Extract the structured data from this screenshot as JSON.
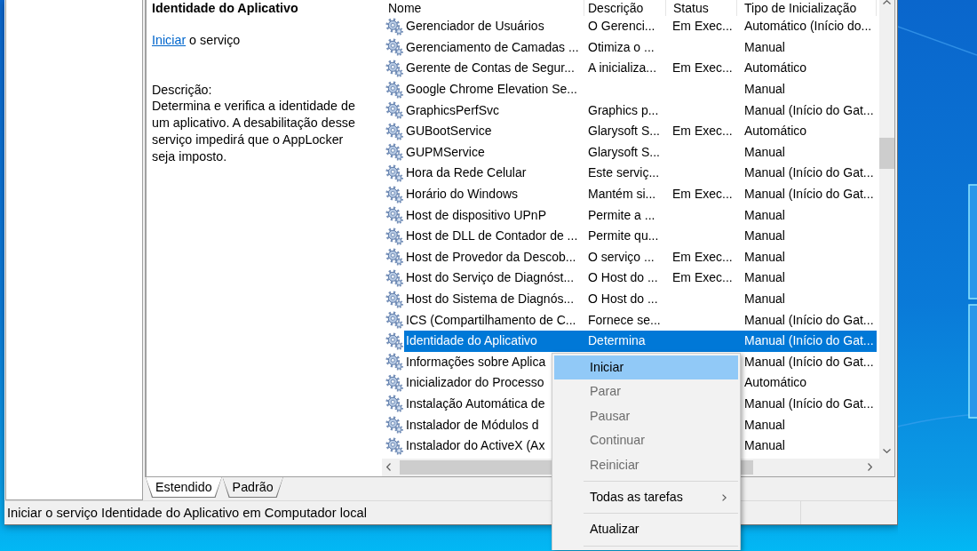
{
  "description_panel": {
    "title": "Identidade do Aplicativo",
    "action_link": "Iniciar",
    "action_text": "o serviço",
    "description_label": "Descrição:",
    "description": "Determina e verifica a identidade de um aplicativo. A desabilitação desse serviço impedirá que o AppLocker seja imposto."
  },
  "services_list": {
    "columns": [
      "Nome",
      "Descrição",
      "Status",
      "Tipo de Inicialização"
    ],
    "rows": [
      {
        "name": "Gerenciador de Usuários",
        "description": "O Gerenci...",
        "status": "Em Exec...",
        "startup_type": "Automático (Início do...",
        "selected": false
      },
      {
        "name": "Gerenciamento de Camadas ...",
        "description": "Otimiza o ...",
        "startup_type": "Manual",
        "selected": false
      },
      {
        "name": "Gerente de Contas de Segur...",
        "description": "A inicializa...",
        "status": "Em Exec...",
        "startup_type": "Automático",
        "selected": false
      },
      {
        "name": "Google Chrome Elevation Se...",
        "startup_type": "Manual",
        "selected": false
      },
      {
        "name": "GraphicsPerfSvc",
        "description": "Graphics p...",
        "startup_type": "Manual (Início do Gat...",
        "selected": false
      },
      {
        "name": "GUBootService",
        "description": "Glarysoft S...",
        "status": "Em Exec...",
        "startup_type": "Automático",
        "selected": false
      },
      {
        "name": "GUPMService",
        "description": "Glarysoft S...",
        "startup_type": "Manual",
        "selected": false
      },
      {
        "name": "Hora da Rede Celular",
        "description": "Este serviç...",
        "startup_type": "Manual (Início do Gat...",
        "selected": false
      },
      {
        "name": "Horário do Windows",
        "description": "Mantém si...",
        "status": "Em Exec...",
        "startup_type": "Manual (Início do Gat...",
        "selected": false
      },
      {
        "name": "Host de dispositivo UPnP",
        "description": "Permite a ...",
        "startup_type": "Manual",
        "selected": false
      },
      {
        "name": "Host de DLL de Contador de ...",
        "description": "Permite qu...",
        "startup_type": "Manual",
        "selected": false
      },
      {
        "name": "Host de Provedor da Descob...",
        "description": "O serviço ...",
        "status": "Em Exec...",
        "startup_type": "Manual",
        "selected": false
      },
      {
        "name": "Host do Serviço de Diagnóst...",
        "description": "O Host do ...",
        "status": "Em Exec...",
        "startup_type": "Manual",
        "selected": false
      },
      {
        "name": "Host do Sistema de Diagnós...",
        "description": "O Host do ...",
        "startup_type": "Manual",
        "selected": false
      },
      {
        "name": "ICS (Compartilhamento de C...",
        "description": "Fornece se...",
        "startup_type": "Manual (Início do Gat...",
        "selected": false
      },
      {
        "name": "Identidade do Aplicativo",
        "description": "Determina",
        "startup_type": "Manual (Início do Gat...",
        "selected": true
      },
      {
        "name": "Informações sobre Aplica",
        "startup_type": "Manual (Início do Gat...",
        "selected": false
      },
      {
        "name": "Inicializador do Processo",
        "startup_type": "Automático",
        "selected": false
      },
      {
        "name": "Instalação Automática de",
        "startup_type": "Manual (Início do Gat...",
        "selected": false
      },
      {
        "name": "Instalador de Módulos d",
        "startup_type": "Manual",
        "selected": false
      },
      {
        "name": "Instalador do ActiveX (Ax",
        "startup_type": "Manual",
        "selected": false
      }
    ]
  },
  "view_tabs": [
    {
      "label": "Estendido",
      "selected": true
    },
    {
      "label": "Padrão",
      "selected": false
    }
  ],
  "status_bar": {
    "text": "Iniciar o serviço Identidade do Aplicativo em Computador local"
  },
  "context_menu": {
    "items": [
      {
        "kind": "item",
        "label": "Iniciar",
        "selected": true,
        "disabled": false,
        "submenu": false
      },
      {
        "kind": "item",
        "label": "Parar",
        "selected": false,
        "disabled": true,
        "submenu": false
      },
      {
        "kind": "item",
        "label": "Pausar",
        "selected": false,
        "disabled": true,
        "submenu": false
      },
      {
        "kind": "item",
        "label": "Continuar",
        "selected": false,
        "disabled": true,
        "submenu": false
      },
      {
        "kind": "item",
        "label": "Reiniciar",
        "selected": false,
        "disabled": true,
        "submenu": false
      },
      {
        "kind": "separator"
      },
      {
        "kind": "item",
        "label": "Todas as tarefas",
        "selected": false,
        "disabled": false,
        "submenu": true
      },
      {
        "kind": "separator"
      },
      {
        "kind": "item",
        "label": "Atualizar",
        "selected": false,
        "disabled": false,
        "submenu": false
      },
      {
        "kind": "separator"
      }
    ]
  }
}
